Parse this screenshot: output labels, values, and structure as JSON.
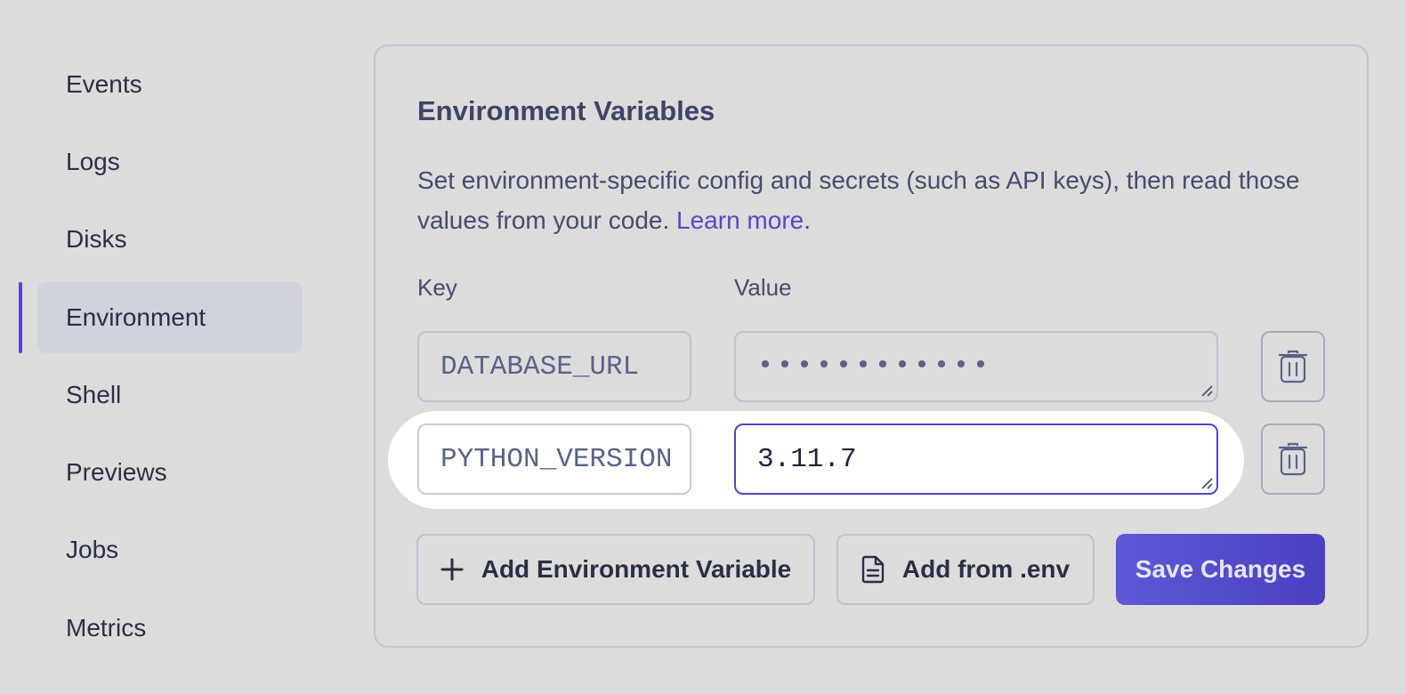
{
  "sidebar": {
    "items": [
      {
        "label": "Events"
      },
      {
        "label": "Logs"
      },
      {
        "label": "Disks"
      },
      {
        "label": "Environment",
        "active": true
      },
      {
        "label": "Shell"
      },
      {
        "label": "Previews"
      },
      {
        "label": "Jobs"
      },
      {
        "label": "Metrics"
      }
    ]
  },
  "env_card": {
    "title": "Environment Variables",
    "description": "Set environment-specific config and secrets (such as API keys), then read those values from your code. ",
    "learn_more_label": "Learn more",
    "description_end": ".",
    "key_column_label": "Key",
    "value_column_label": "Value",
    "rows": [
      {
        "key": "DATABASE_URL",
        "value": "••••••••••••",
        "masked": true
      },
      {
        "key": "PYTHON_VERSION",
        "value": "3.11.7",
        "masked": false
      }
    ],
    "add_variable_label": "Add Environment Variable",
    "add_from_env_label": "Add from .env",
    "save_label": "Save Changes"
  },
  "colors": {
    "accent": "#5548c8",
    "primary_button": "#5247c8",
    "background": "#dcdcdc"
  },
  "icons": {
    "delete": "trash-icon",
    "add": "plus-icon",
    "file": "document-icon"
  }
}
